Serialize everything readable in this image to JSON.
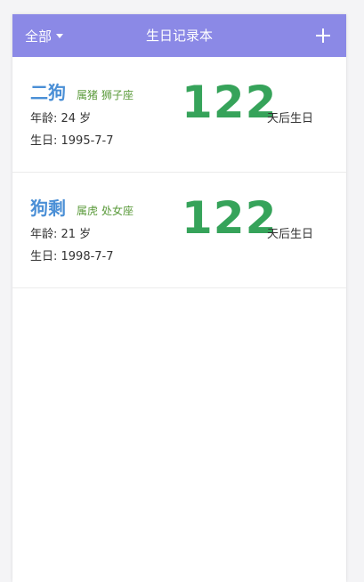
{
  "header": {
    "filter_label": "全部",
    "title": "生日记录本",
    "add_icon": "plus-icon",
    "background_color": "#8b89e6"
  },
  "records": [
    {
      "name": "二狗",
      "zodiac": "属猪",
      "constellation": "狮子座",
      "age_label": "年龄: 24 岁",
      "birthday_label": "生日: 1995-7-7",
      "days_until": "122",
      "days_suffix": "天后生日"
    },
    {
      "name": "狗剩",
      "zodiac": "属虎",
      "constellation": "处女座",
      "age_label": "年龄: 21 岁",
      "birthday_label": "生日: 1998-7-7",
      "days_until": "122",
      "days_suffix": "天后生日"
    }
  ],
  "colors": {
    "name": "#4a8fd6",
    "tags": "#5a9a3a",
    "days": "#36a35a"
  }
}
